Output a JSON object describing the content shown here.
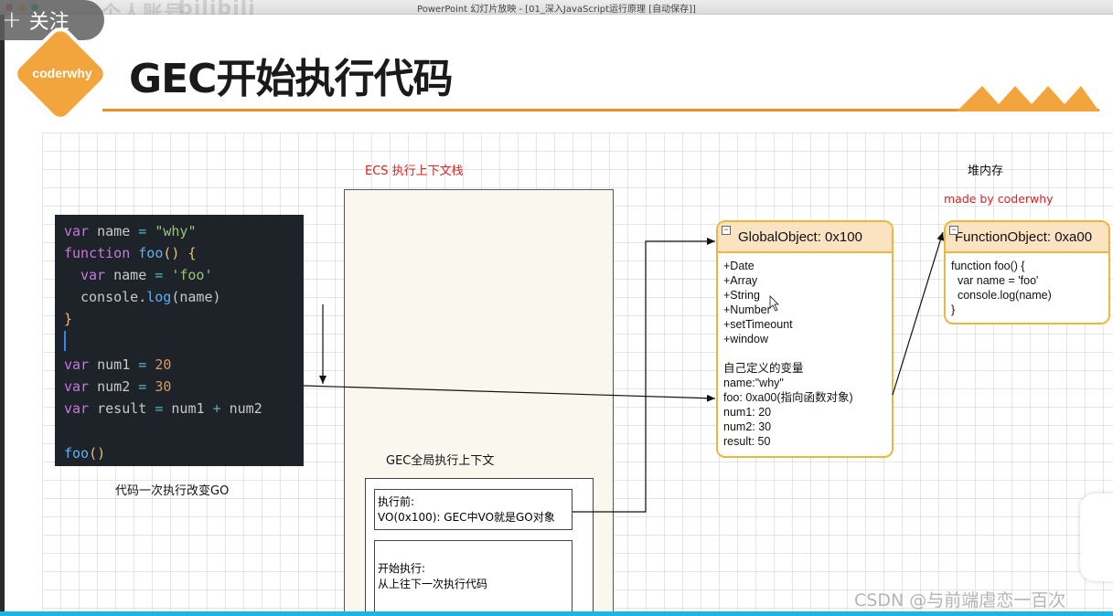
{
  "window": {
    "title": "PowerPoint 幻灯片放映 - [01_深入JavaScript运行原理 [自动保存]]",
    "ghost_text_1": "个人账号",
    "ghost_text_2": "bilibili"
  },
  "follow_button": {
    "plus": "+",
    "label": "关注"
  },
  "slide": {
    "logo_text": "coderwhy",
    "title": "GEC开始执行代码",
    "ecs_label": "ECS 执行上下文栈",
    "heap_label": "堆内存",
    "made_by": "made by coderwhy",
    "code_caption": "代码一次执行改变GO",
    "gec_label": "GEC全局执行上下文",
    "vo_box": {
      "line1": "执行前:",
      "line2": "VO(0x100): GEC中VO就是GO对象"
    },
    "exec_box": {
      "line1": "开始执行:",
      "line2": "从上往下一次执行代码"
    },
    "global_object": {
      "header": "GlobalObject: 0x100",
      "props": [
        "+Date",
        "+Array",
        "+String",
        "+Number",
        "+setTimeount",
        "+window"
      ],
      "section": "自己定义的变量",
      "vars": [
        "name:\"why\"",
        "foo: 0xa00(指向函数对象)",
        "num1: 20",
        "num2: 30",
        "result: 50"
      ]
    },
    "function_object": {
      "header": "FunctionObject: 0xa00",
      "code": [
        "function foo() {",
        "  var name = 'foo'",
        "  console.log(name)",
        "}"
      ]
    }
  },
  "code": {
    "l1": {
      "kw": "var",
      "id": "name",
      "op": "=",
      "str": "\"why\""
    },
    "l2": {
      "kw": "function",
      "fn": "foo",
      "p": "()",
      "b": "{"
    },
    "l3": {
      "kw": "var",
      "id": "name",
      "op": "=",
      "str": "'foo'"
    },
    "l4": {
      "obj": "console.",
      "fn": "log",
      "open": "(",
      "id": "name",
      "close": ")"
    },
    "l5": {
      "b": "}"
    },
    "l7": {
      "kw": "var",
      "id": "num1",
      "op": "=",
      "num": "20"
    },
    "l8": {
      "kw": "var",
      "id": "num2",
      "op": "=",
      "num": "30"
    },
    "l9": {
      "kw": "var",
      "id": "result",
      "op": "=",
      "a": "num1",
      "plus": "+",
      "b": "num2"
    },
    "l11": {
      "fn": "foo",
      "p": "()"
    }
  },
  "watermark": "CSDN @与前端虐恋一百次",
  "colors": {
    "accent_orange": "#e9922b",
    "object_border": "#e8b840",
    "object_header": "#fbe3c2",
    "code_bg": "#1e2229",
    "label_red": "#e02020"
  }
}
